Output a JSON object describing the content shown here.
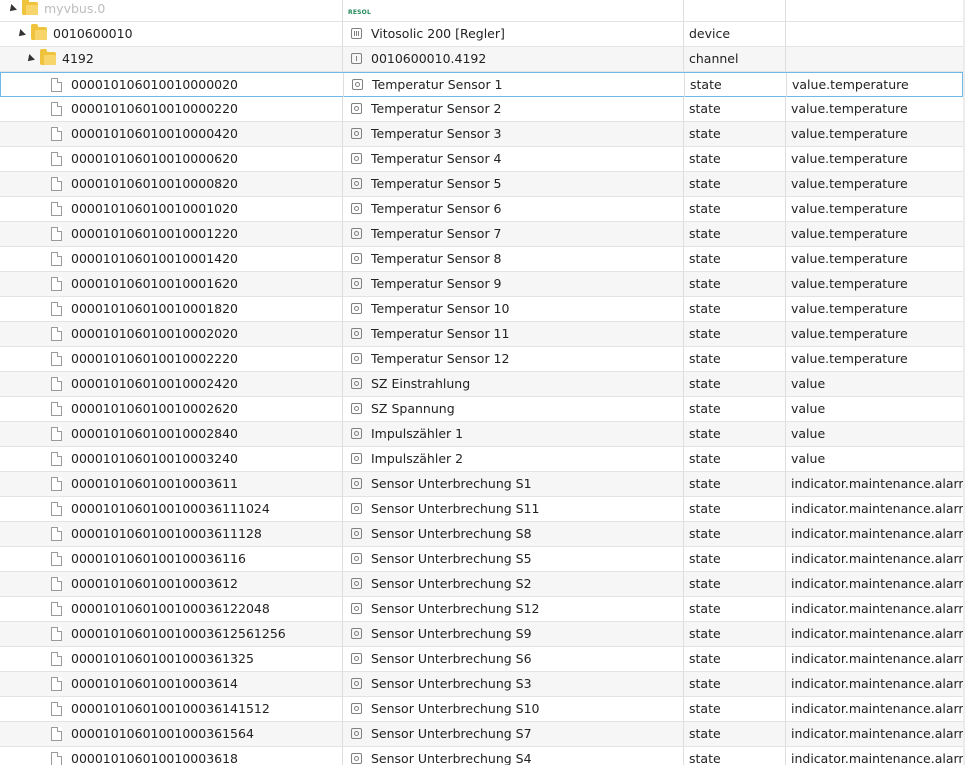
{
  "tree": {
    "root": {
      "id": "myvbus.0",
      "logo": "RESOL"
    },
    "device": {
      "id": "0010600010",
      "name": "Vitosolic 200 [Regler]",
      "type": "device"
    },
    "channel": {
      "id": "4192",
      "name": "0010600010.4192",
      "type": "channel"
    },
    "states": [
      {
        "id": "000010106010010000020",
        "name": "Temperatur Sensor 1",
        "type": "state",
        "role": "value.temperature"
      },
      {
        "id": "000010106010010000220",
        "name": "Temperatur Sensor 2",
        "type": "state",
        "role": "value.temperature"
      },
      {
        "id": "000010106010010000420",
        "name": "Temperatur Sensor 3",
        "type": "state",
        "role": "value.temperature"
      },
      {
        "id": "000010106010010000620",
        "name": "Temperatur Sensor 4",
        "type": "state",
        "role": "value.temperature"
      },
      {
        "id": "000010106010010000820",
        "name": "Temperatur Sensor 5",
        "type": "state",
        "role": "value.temperature"
      },
      {
        "id": "000010106010010001020",
        "name": "Temperatur Sensor 6",
        "type": "state",
        "role": "value.temperature"
      },
      {
        "id": "000010106010010001220",
        "name": "Temperatur Sensor 7",
        "type": "state",
        "role": "value.temperature"
      },
      {
        "id": "000010106010010001420",
        "name": "Temperatur Sensor 8",
        "type": "state",
        "role": "value.temperature"
      },
      {
        "id": "000010106010010001620",
        "name": "Temperatur Sensor 9",
        "type": "state",
        "role": "value.temperature"
      },
      {
        "id": "000010106010010001820",
        "name": "Temperatur Sensor 10",
        "type": "state",
        "role": "value.temperature"
      },
      {
        "id": "000010106010010002020",
        "name": "Temperatur Sensor 11",
        "type": "state",
        "role": "value.temperature"
      },
      {
        "id": "000010106010010002220",
        "name": "Temperatur Sensor 12",
        "type": "state",
        "role": "value.temperature"
      },
      {
        "id": "000010106010010002420",
        "name": "SZ Einstrahlung",
        "type": "state",
        "role": "value"
      },
      {
        "id": "000010106010010002620",
        "name": "SZ Spannung",
        "type": "state",
        "role": "value"
      },
      {
        "id": "000010106010010002840",
        "name": "Impulszähler 1",
        "type": "state",
        "role": "value"
      },
      {
        "id": "000010106010010003240",
        "name": "Impulszähler 2",
        "type": "state",
        "role": "value"
      },
      {
        "id": "000010106010010003611",
        "name": "Sensor Unterbrechung S1",
        "type": "state",
        "role": "indicator.maintenance.alarm"
      },
      {
        "id": "0000101060100100036111024",
        "name": "Sensor Unterbrechung S11",
        "type": "state",
        "role": "indicator.maintenance.alarm"
      },
      {
        "id": "000010106010010003611128",
        "name": "Sensor Unterbrechung S8",
        "type": "state",
        "role": "indicator.maintenance.alarm"
      },
      {
        "id": "0000101060100100036116",
        "name": "Sensor Unterbrechung S5",
        "type": "state",
        "role": "indicator.maintenance.alarm"
      },
      {
        "id": "000010106010010003612",
        "name": "Sensor Unterbrechung S2",
        "type": "state",
        "role": "indicator.maintenance.alarm"
      },
      {
        "id": "0000101060100100036122048",
        "name": "Sensor Unterbrechung S12",
        "type": "state",
        "role": "indicator.maintenance.alarm"
      },
      {
        "id": "000010106010010003612561256",
        "name": "Sensor Unterbrechung S9",
        "type": "state",
        "role": "indicator.maintenance.alarm"
      },
      {
        "id": "00001010601001000361325",
        "name": "Sensor Unterbrechung S6",
        "type": "state",
        "role": "indicator.maintenance.alarm"
      },
      {
        "id": "000010106010010003614",
        "name": "Sensor Unterbrechung S3",
        "type": "state",
        "role": "indicator.maintenance.alarm"
      },
      {
        "id": "0000101060100100036141512",
        "name": "Sensor Unterbrechung S10",
        "type": "state",
        "role": "indicator.maintenance.alarm"
      },
      {
        "id": "00001010601001000361564",
        "name": "Sensor Unterbrechung S7",
        "type": "state",
        "role": "indicator.maintenance.alarm"
      },
      {
        "id": "000010106010010003618",
        "name": "Sensor Unterbrechung S4",
        "type": "state",
        "role": "indicator.maintenance.alarm"
      }
    ]
  }
}
